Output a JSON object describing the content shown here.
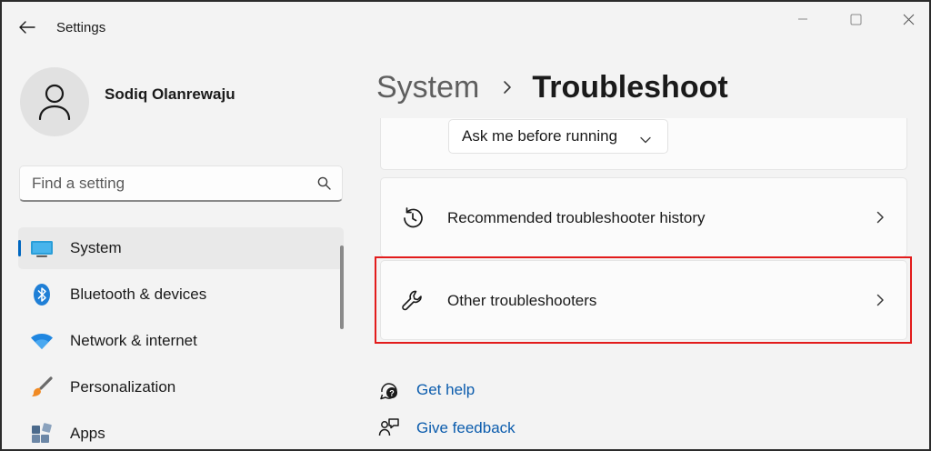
{
  "window": {
    "title": "Settings"
  },
  "profile": {
    "name": "Sodiq Olanrewaju"
  },
  "search": {
    "placeholder": "Find a setting"
  },
  "sidebar": {
    "items": [
      {
        "label": "System",
        "icon": "monitor-icon",
        "selected": true
      },
      {
        "label": "Bluetooth & devices",
        "icon": "bluetooth-icon"
      },
      {
        "label": "Network & internet",
        "icon": "wifi-icon"
      },
      {
        "label": "Personalization",
        "icon": "paintbrush-icon"
      },
      {
        "label": "Apps",
        "icon": "apps-icon"
      }
    ]
  },
  "breadcrumb": {
    "parent": "System",
    "current": "Troubleshoot"
  },
  "main": {
    "dropdown_value": "Ask me before running",
    "rows": [
      {
        "label": "Recommended troubleshooter history",
        "icon": "history-icon"
      },
      {
        "label": "Other troubleshooters",
        "icon": "wrench-icon",
        "highlighted": true
      }
    ]
  },
  "help_links": {
    "get_help": "Get help",
    "give_feedback": "Give feedback"
  },
  "colors": {
    "accent": "#0067c0",
    "highlight": "#e21b1b",
    "link": "#0b5cad"
  }
}
